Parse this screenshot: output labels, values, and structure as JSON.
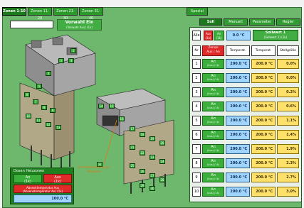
{
  "tabs": [
    {
      "label": "Zonen 1-10",
      "active": true
    },
    {
      "label": "Zonen 11-20",
      "active": false
    },
    {
      "label": "Zonen 21-30",
      "active": false
    },
    {
      "label": "Zonen 31-40",
      "active": false
    },
    {
      "label": "Spezial",
      "active": false
    }
  ],
  "toolbar": {
    "search_value": "",
    "vorwahl_title": "Vorwahl Ein",
    "vorwahl_sub": "(Vorwahl Aus) (1k)"
  },
  "right_tabs": [
    {
      "label": "Soll",
      "active": true
    },
    {
      "label": "Manuell",
      "active": false
    },
    {
      "label": "Parameter",
      "active": false
    },
    {
      "label": "Regler",
      "active": false
    }
  ],
  "header": {
    "alle": "Alle",
    "aus": "Aus",
    "aus_sub": "(1k)",
    "an": "An",
    "an_sub": "(1k)",
    "temp": "0.0 °C",
    "sollwert_title": "Sollwert 1",
    "sollwert_sub": "(Sollwert 2) (1k)"
  },
  "table": {
    "col_nr": "Nr",
    "col_zone_a": "Zonen",
    "col_zone_b": "Aus / An",
    "col_temp1": "Temperat.",
    "col_temp2": "Temperat.",
    "col_stell": "Stellgröße",
    "rows": [
      {
        "nr": "1",
        "state": "An",
        "state_sub": "(Aus) (1k)",
        "temp1": "200.0 °C",
        "temp2": "200.0 °C",
        "stell": "0.0%"
      },
      {
        "nr": "2",
        "state": "An",
        "state_sub": "(Aus) (1k)",
        "temp1": "200.0 °C",
        "temp2": "200.0 °C",
        "stell": "0.0%"
      },
      {
        "nr": "3",
        "state": "An",
        "state_sub": "(Aus) (1k)",
        "temp1": "200.0 °C",
        "temp2": "200.0 °C",
        "stell": "0.2%"
      },
      {
        "nr": "4",
        "state": "An",
        "state_sub": "(Aus) (1k)",
        "temp1": "200.0 °C",
        "temp2": "200.0 °C",
        "stell": "0.6%"
      },
      {
        "nr": "5",
        "state": "An",
        "state_sub": "(Aus) (1k)",
        "temp1": "200.0 °C",
        "temp2": "200.0 °C",
        "stell": "1.1%"
      },
      {
        "nr": "6",
        "state": "An",
        "state_sub": "(Aus) (1k)",
        "temp1": "200.0 °C",
        "temp2": "200.0 °C",
        "stell": "1.4%"
      },
      {
        "nr": "7",
        "state": "An",
        "state_sub": "(Aus) (1k)",
        "temp1": "200.0 °C",
        "temp2": "200.0 °C",
        "stell": "1.9%"
      },
      {
        "nr": "8",
        "state": "An",
        "state_sub": "(Aus) (1k)",
        "temp1": "200.0 °C",
        "temp2": "200.0 °C",
        "stell": "2.3%"
      },
      {
        "nr": "9",
        "state": "An",
        "state_sub": "(Aus) (1k)",
        "temp1": "200.0 °C",
        "temp2": "200.0 °C",
        "stell": "2.7%"
      },
      {
        "nr": "10",
        "state": "An",
        "state_sub": "(Aus) (1k)",
        "temp1": "200.0 °C",
        "temp2": "200.0 °C",
        "stell": "3.0%"
      }
    ]
  },
  "dosen": {
    "title": "Dosen Heizzonen",
    "an": "An",
    "an_sub": "(1k)",
    "aus": "Aus",
    "aus_sub": "(1k)",
    "absenk_title": "Absenktemperatur Aus",
    "absenk_sub": "(Absenktemperatur An) (1k)",
    "value": "100.0 °C"
  },
  "illustration": {
    "note": "Schnittdarstellung der Heizzonen",
    "markers": [
      "1",
      "2",
      "3",
      "4",
      "5",
      "6",
      "7",
      "8",
      "9",
      "10",
      "11",
      "12",
      "13",
      "14",
      "15",
      "16",
      "17",
      "18",
      "19",
      "20",
      "21",
      "22",
      "23",
      "24",
      "25",
      "26",
      "27",
      "28",
      "29",
      "30",
      "31"
    ]
  },
  "colors": {
    "background_green": "#6db86d",
    "button_green": "#3cae3c",
    "aus_red": "#e02a2a",
    "temp_blue": "#9fd4ff",
    "temp_yellow": "#ffe16a"
  }
}
